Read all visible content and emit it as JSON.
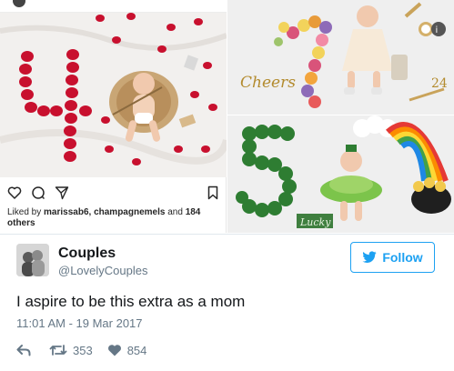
{
  "instagram": {
    "likes_prefix": "Liked by",
    "likers": "marissab6, champagnemels",
    "likes_join": "and",
    "likes_count": "184",
    "likes_suffix": "others",
    "photo_numeral": "4"
  },
  "photos": {
    "top_right_label": "Cheers",
    "bottom_right_label": "Lucky",
    "bottom_right_numeral": "5"
  },
  "tweet": {
    "name": "Couples",
    "handle": "@LovelyCouples",
    "follow_label": "Follow",
    "text": "I aspire to be this extra as a mom",
    "timestamp": "11:01 AM - 19 Mar 2017",
    "retweets": "353",
    "likes": "854"
  },
  "colors": {
    "twitter_blue": "#1da1f2",
    "muted_text": "#657786",
    "rose_red": "#c8102e",
    "clover_green": "#2e7d32"
  },
  "icons": {
    "insta_like": "heart-outline-icon",
    "insta_comment": "comment-bubble-icon",
    "insta_share": "paper-plane-icon",
    "insta_save": "bookmark-icon",
    "follow": "twitter-bird-icon",
    "reply": "reply-arrow-icon",
    "retweet": "retweet-icon",
    "like": "heart-icon"
  }
}
